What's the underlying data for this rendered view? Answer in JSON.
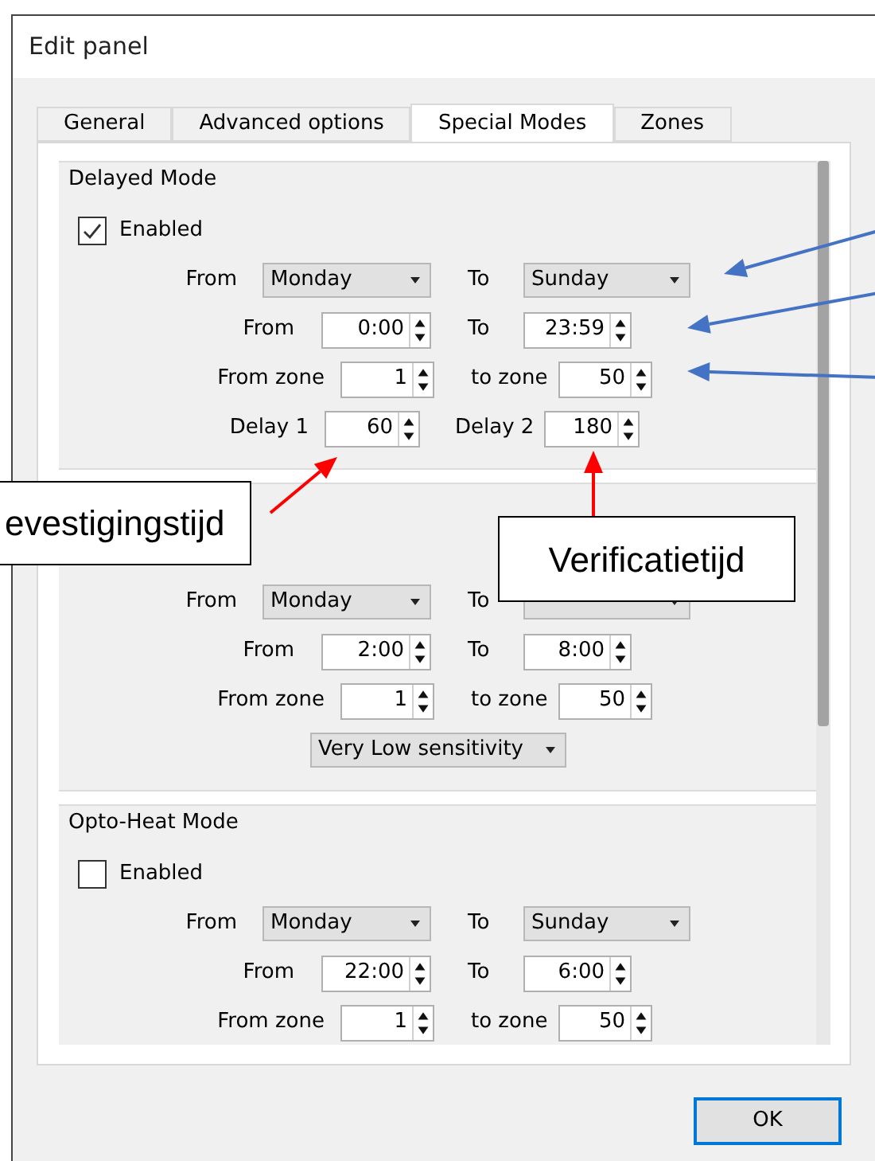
{
  "window": {
    "title": "Edit panel"
  },
  "tabs": [
    {
      "label": "General",
      "selected": false
    },
    {
      "label": "Advanced options",
      "selected": false
    },
    {
      "label": "Special Modes",
      "selected": true
    },
    {
      "label": "Zones",
      "selected": false
    }
  ],
  "sections": [
    {
      "title": "Delayed Mode",
      "checkbox": {
        "label": "Enabled",
        "checked": true
      },
      "rows": [
        {
          "kind": "days",
          "from_label": "From",
          "from": "Monday",
          "to_label": "To",
          "to": "Sunday"
        },
        {
          "kind": "times",
          "from_label": "From",
          "from": "0:00",
          "to_label": "To",
          "to": "23:59"
        },
        {
          "kind": "zones",
          "from_label": "From zone",
          "from": "1",
          "to_label": "to zone",
          "to": "50"
        },
        {
          "kind": "delays",
          "from_label": "Delay 1",
          "from": "60",
          "to_label": "Delay 2",
          "to": "180"
        }
      ]
    },
    {
      "rows": [
        {
          "kind": "days",
          "from_label": "From",
          "from": "Monday",
          "to_label": "To"
        },
        {
          "kind": "times",
          "from_label": "From",
          "from": "2:00",
          "to_label": "To",
          "to": "8:00"
        },
        {
          "kind": "zones",
          "from_label": "From zone",
          "from": "1",
          "to_label": "to zone",
          "to": "50"
        },
        {
          "kind": "select",
          "value": "Very Low sensitivity"
        }
      ]
    },
    {
      "title": "Opto-Heat Mode",
      "checkbox": {
        "label": "Enabled",
        "checked": false
      },
      "rows": [
        {
          "kind": "days",
          "from_label": "From",
          "from": "Monday",
          "to_label": "To",
          "to": "Sunday"
        },
        {
          "kind": "times",
          "from_label": "From",
          "from": "22:00",
          "to_label": "To",
          "to": "6:00"
        },
        {
          "kind": "zones",
          "from_label": "From zone",
          "from": "1",
          "to_label": "to zone",
          "to": "50"
        }
      ]
    }
  ],
  "callouts": [
    "evestigingstijd",
    "Verificatietijd"
  ],
  "buttons": [
    "OK"
  ]
}
